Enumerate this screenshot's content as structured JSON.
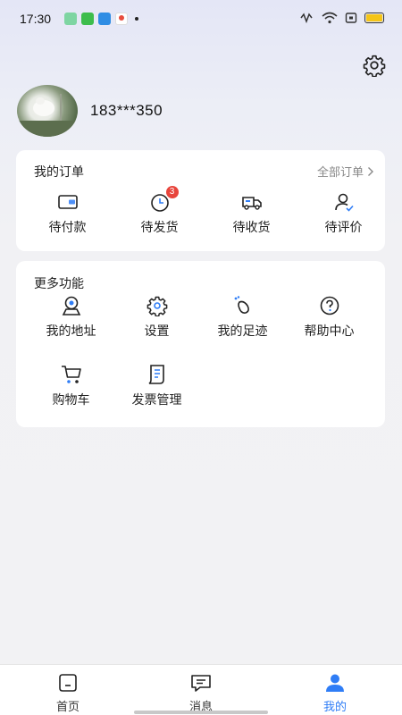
{
  "status_bar": {
    "time": "17:30",
    "notif_icons": [
      "download-app-icon",
      "green-app-icon",
      "blue-app-icon",
      "map-app-icon"
    ],
    "battery_color": "#f5c518"
  },
  "profile": {
    "phone": "183***350"
  },
  "orders": {
    "title": "我的订单",
    "all_link": "全部订单",
    "items": [
      {
        "label": "待付款",
        "icon": "wallet-icon"
      },
      {
        "label": "待发货",
        "icon": "clock-icon",
        "badge": "3"
      },
      {
        "label": "待收货",
        "icon": "truck-icon"
      },
      {
        "label": "待评价",
        "icon": "user-check-icon"
      }
    ]
  },
  "more": {
    "title": "更多功能",
    "items": [
      {
        "label": "我的地址",
        "icon": "location-icon"
      },
      {
        "label": "设置",
        "icon": "gear-icon"
      },
      {
        "label": "我的足迹",
        "icon": "footprint-icon"
      },
      {
        "label": "帮助中心",
        "icon": "help-icon"
      },
      {
        "label": "购物车",
        "icon": "cart-icon"
      },
      {
        "label": "发票管理",
        "icon": "invoice-icon"
      }
    ]
  },
  "tabbar": {
    "items": [
      {
        "label": "首页",
        "icon": "home-icon"
      },
      {
        "label": "消息",
        "icon": "message-icon"
      },
      {
        "label": "我的",
        "icon": "profile-icon",
        "active": true
      }
    ],
    "accent": "#2f7df6"
  }
}
